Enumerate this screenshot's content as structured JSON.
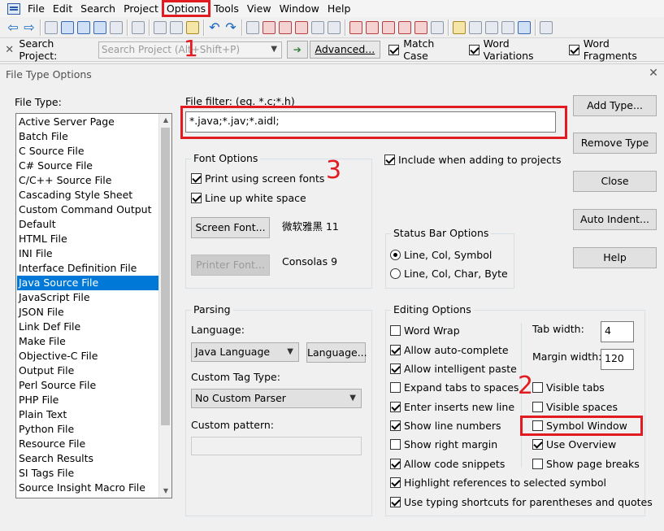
{
  "menubar": {
    "items": [
      "File",
      "Edit",
      "Search",
      "Project",
      "Options",
      "Tools",
      "View",
      "Window",
      "Help"
    ],
    "highlighted": "Options"
  },
  "search_bar": {
    "label": "Search Project:",
    "placeholder": "Search Project (Alt+Shift+P)",
    "advanced_label": "Advanced...",
    "checks": [
      {
        "label": "Match Case",
        "checked": true
      },
      {
        "label": "Word Variations",
        "checked": true
      },
      {
        "label": "Word Fragments",
        "checked": true
      }
    ]
  },
  "dialog": {
    "title": "File Type Options",
    "file_type_label": "File Type:",
    "file_types": [
      "Active Server Page",
      "Batch File",
      "C Source File",
      "C# Source File",
      "C/C++ Source File",
      "Cascading Style Sheet",
      "Custom Command Output",
      "Default",
      "HTML File",
      "INI File",
      "Interface Definition File",
      "Java Source File",
      "JavaScript File",
      "JSON File",
      "Link Def File",
      "Make File",
      "Objective-C File",
      "Output File",
      "Perl Source File",
      "PHP File",
      "Plain Text",
      "Python File",
      "Resource File",
      "Search Results",
      "SI Tags File",
      "Source Insight Macro File"
    ],
    "selected_file_type": "Java Source File",
    "file_filter_label": "File filter: (eg. *.c;*.h)",
    "file_filter_value": "*.java;*.jav;*.aidl;",
    "buttons": {
      "add_type": "Add Type...",
      "remove_type": "Remove Type",
      "close": "Close",
      "auto_indent": "Auto Indent...",
      "help": "Help"
    },
    "font_options": {
      "title": "Font Options",
      "print_screen_fonts": "Print using screen fonts",
      "line_up_white_space": "Line up white space",
      "screen_font_button": "Screen Font...",
      "screen_font_value": "微软雅黑 11",
      "printer_font_button": "Printer Font...",
      "printer_font_value": "Consolas 9"
    },
    "include_when_adding": "Include when adding to projects",
    "status_bar": {
      "title": "Status Bar Options",
      "opt1": "Line, Col, Symbol",
      "opt2": "Line, Col, Char, Byte"
    },
    "parsing": {
      "title": "Parsing",
      "language_label": "Language:",
      "language_value": "Java Language",
      "language_button": "Language...",
      "custom_tag_label": "Custom Tag Type:",
      "custom_tag_value": "No Custom Parser",
      "custom_pattern_label": "Custom pattern:",
      "custom_pattern_value": ""
    },
    "editing": {
      "title": "Editing Options",
      "left": [
        {
          "label": "Word Wrap",
          "checked": false
        },
        {
          "label": "Allow auto-complete",
          "checked": true
        },
        {
          "label": "Allow intelligent paste",
          "checked": true
        },
        {
          "label": "Expand tabs to spaces",
          "checked": false
        },
        {
          "label": "Enter inserts new line",
          "checked": true
        },
        {
          "label": "Show line numbers",
          "checked": true
        },
        {
          "label": "Show right margin",
          "checked": false
        },
        {
          "label": "Allow code snippets",
          "checked": true
        }
      ],
      "tab_width_label": "Tab width:",
      "tab_width_value": "4",
      "margin_width_label": "Margin width:",
      "margin_width_value": "120",
      "right": [
        {
          "label": "Visible tabs",
          "checked": false
        },
        {
          "label": "Visible spaces",
          "checked": false
        },
        {
          "label": "Symbol Window",
          "checked": false
        },
        {
          "label": "Use Overview",
          "checked": true
        },
        {
          "label": "Show page breaks",
          "checked": false
        }
      ],
      "bottom": [
        {
          "label": "Highlight references to selected symbol",
          "checked": true
        },
        {
          "label": "Use typing shortcuts for parentheses and quotes",
          "checked": true
        }
      ]
    }
  },
  "annotations": [
    "1",
    "2",
    "3"
  ],
  "colors": {
    "annotation": "#e21b23",
    "selection": "#0078d7"
  }
}
